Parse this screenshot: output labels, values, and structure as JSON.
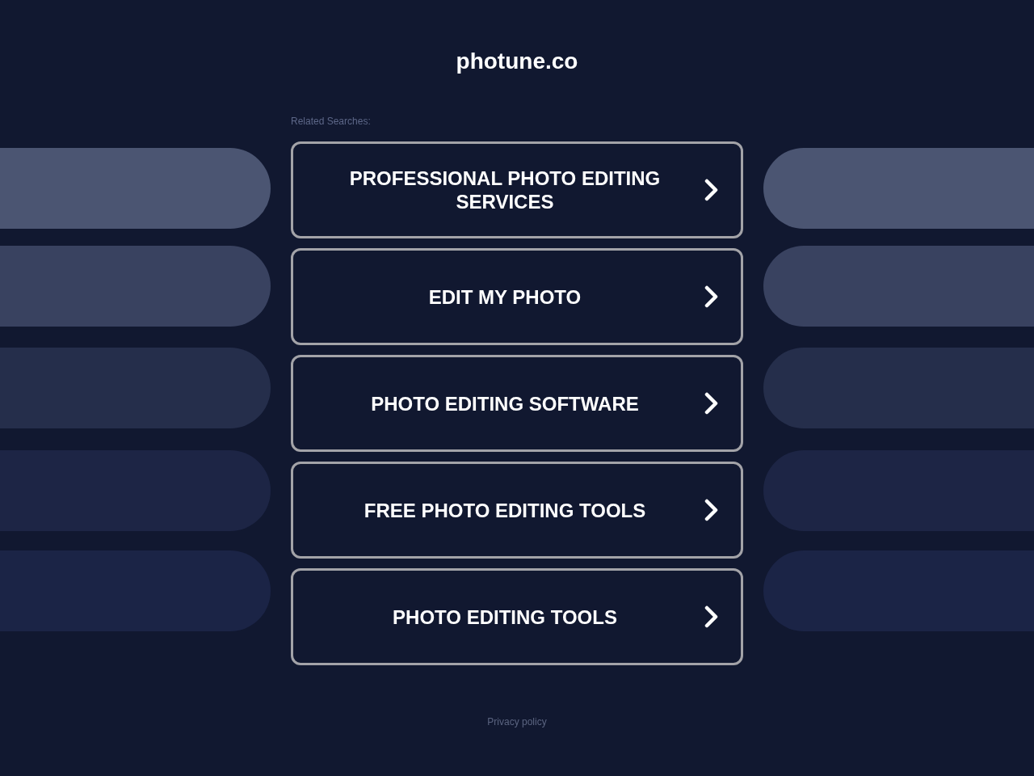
{
  "header": {
    "title": "photune.co"
  },
  "related": {
    "label": "Related Searches:",
    "links": [
      "PROFESSIONAL PHOTO EDITING SERVICES",
      "EDIT MY PHOTO",
      "PHOTO EDITING SOFTWARE",
      "FREE PHOTO EDITING TOOLS",
      "PHOTO EDITING TOOLS"
    ]
  },
  "footer": {
    "privacy_link": "Privacy policy"
  }
}
